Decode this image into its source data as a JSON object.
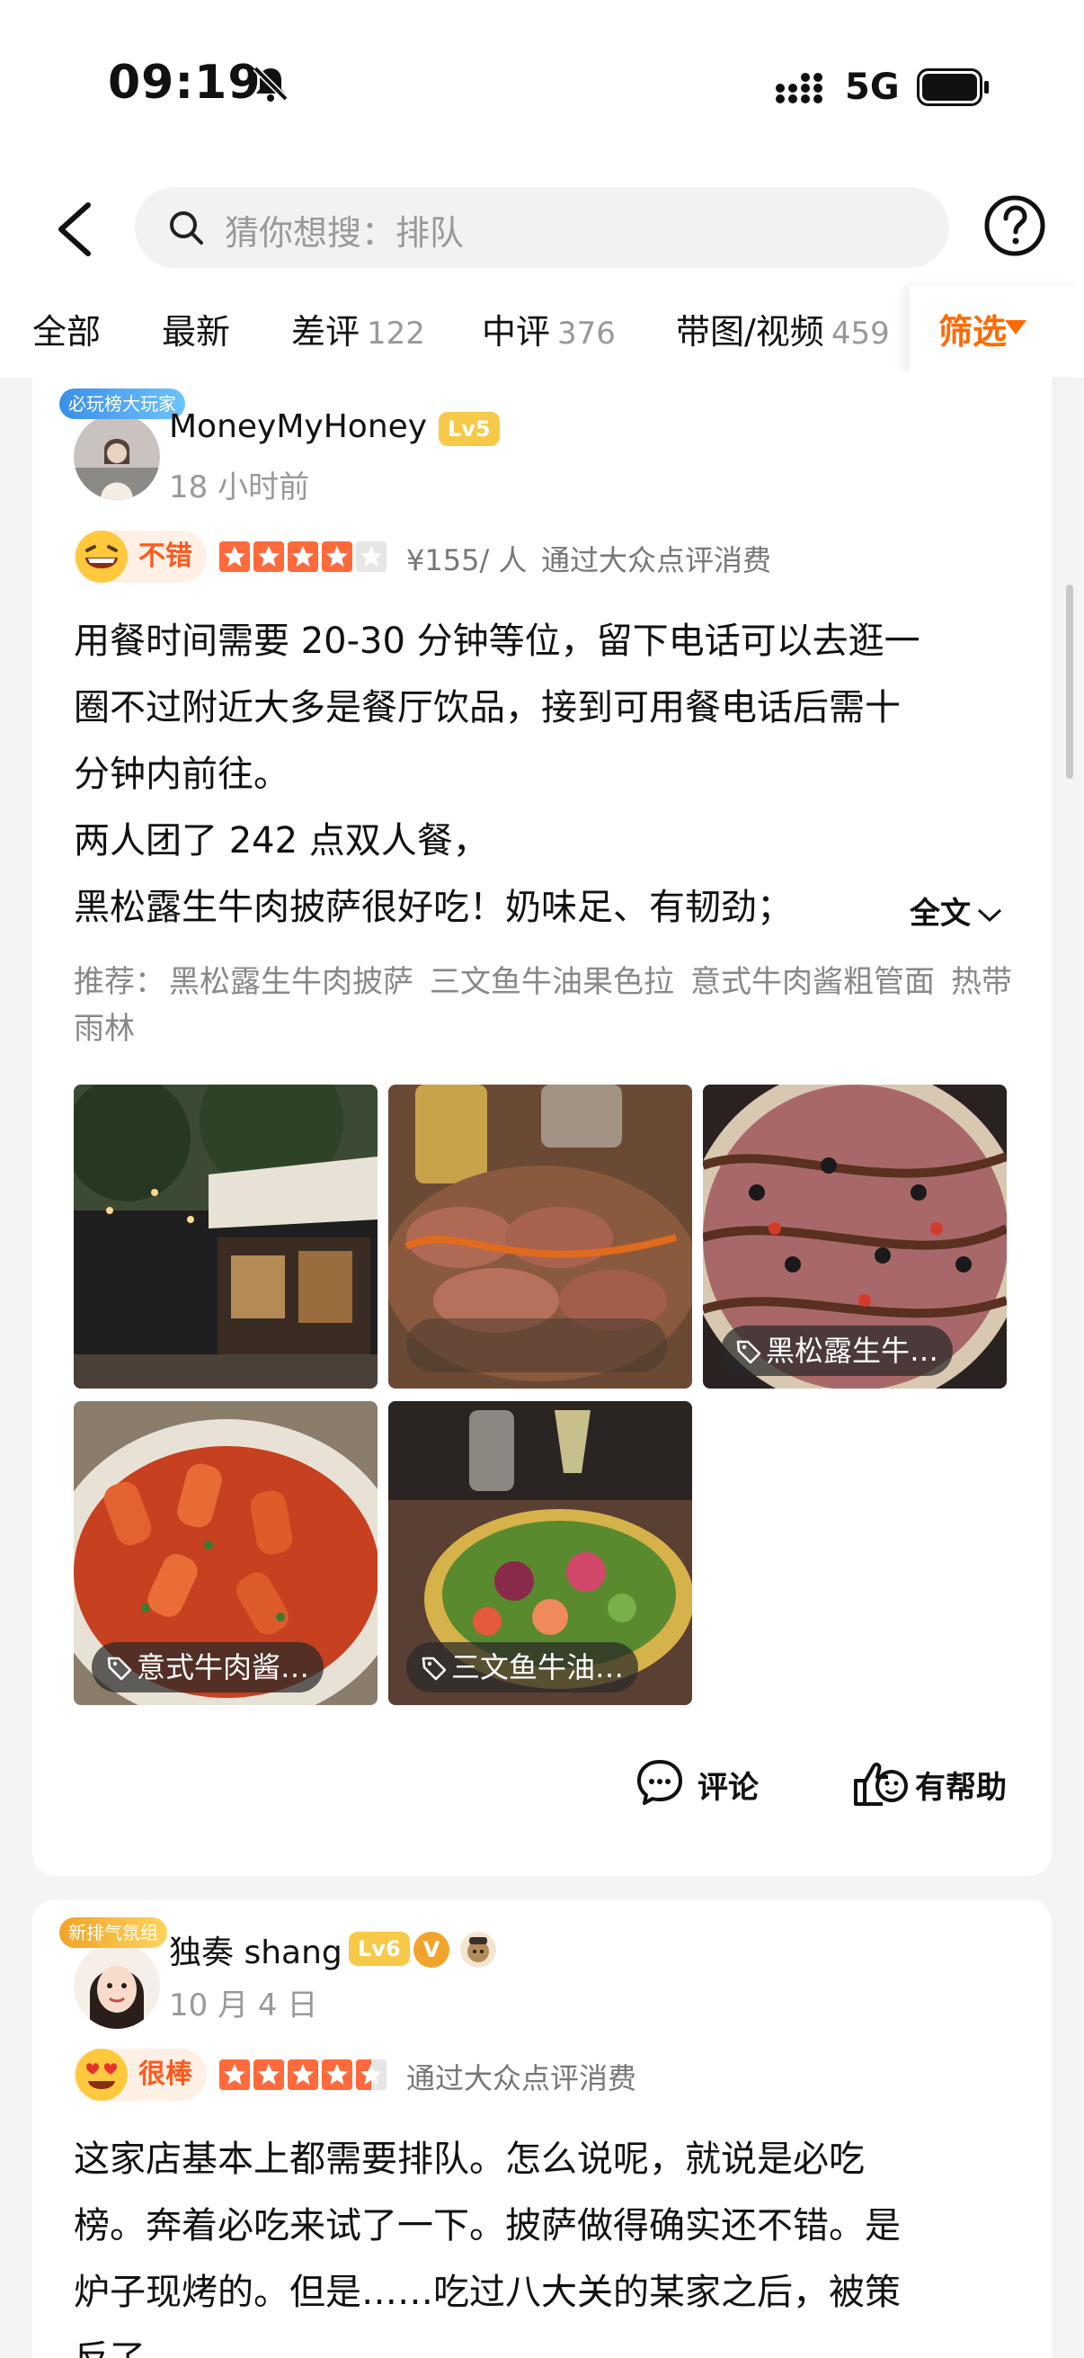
{
  "status_bar": {
    "time": "09:19",
    "network": "5G"
  },
  "search": {
    "placeholder": "猜你想搜：排队"
  },
  "tabs": [
    {
      "label": "全部",
      "count": ""
    },
    {
      "label": "最新",
      "count": ""
    },
    {
      "label": "差评",
      "count": "122"
    },
    {
      "label": "中评",
      "count": "376"
    },
    {
      "label": "带图/视频",
      "count": "459"
    }
  ],
  "filter_label": "筛选",
  "colors": {
    "accent": "#ff6a00",
    "star": "#ff6a3d",
    "level_badge": "#f7c948"
  },
  "reviews": [
    {
      "user_name": "MoneyMyHoney",
      "level": "Lv5",
      "avatar_badge": "必玩榜大玩家",
      "posted": "18 小时前",
      "mood": "不错",
      "rating": 4,
      "price": "¥155/ 人",
      "source": "通过大众点评消费",
      "text_lines": [
        "用餐时间需要 20-30 分钟等位，留下电话可以去逛一",
        "圈不过附近大多是餐厅饮品，接到可用餐电话后需十",
        "分钟内前往。",
        "两人团了 242 点双人餐，",
        "黑松露生牛肉披萨很好吃！奶味足、有韧劲；"
      ],
      "full_text_label": "全文",
      "recommend_label": "推荐：",
      "recommend": [
        "黑松露生牛肉披萨",
        "三文鱼牛油果色拉",
        "意式牛肉酱粗管面",
        "热带雨林"
      ],
      "photo_tags": [
        "",
        "",
        "黑松露生牛…",
        "意式牛肉酱…",
        "三文鱼牛油…"
      ],
      "comment_label": "评论",
      "helpful_label": "有帮助"
    },
    {
      "user_name": "独奏 shang",
      "level": "Lv6",
      "v_badge": "V",
      "avatar_badge": "新排气氛组",
      "posted": "10 月 4 日",
      "mood": "很棒",
      "rating": 4.5,
      "source": "通过大众点评消费",
      "text_lines": [
        "这家店基本上都需要排队。怎么说呢，就说是必吃",
        "榜。奔着必吃来试了一下。披萨做得确实还不错。是",
        "炉子现烤的。但是……吃过八大关的某家之后，被策",
        "反了。"
      ]
    }
  ]
}
